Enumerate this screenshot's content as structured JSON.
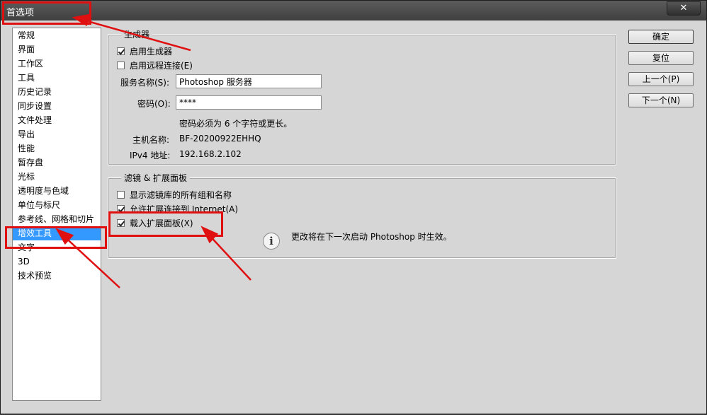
{
  "window": {
    "title": "首选项",
    "close_glyph": "✕"
  },
  "nav": {
    "items": [
      "常规",
      "界面",
      "工作区",
      "工具",
      "历史记录",
      "同步设置",
      "文件处理",
      "导出",
      "性能",
      "暂存盘",
      "光标",
      "透明度与色域",
      "单位与标尺",
      "参考线、网格和切片",
      "增效工具",
      "文字",
      "3D",
      "技术预览"
    ],
    "selected_index": 14
  },
  "generator": {
    "title": "生成器",
    "enable": {
      "label": "启用生成器",
      "checked": true
    },
    "remote": {
      "label": "启用远程连接(E)",
      "checked": false
    },
    "service_name": {
      "label": "服务名称(S):",
      "value": "Photoshop 服务器"
    },
    "password": {
      "label": "密码(O):",
      "value": "****"
    },
    "password_hint": "密码必须为 6 个字符或更长。",
    "host": {
      "label": "主机名称:",
      "value": "BF-20200922EHHQ"
    },
    "ipv4": {
      "label": "IPv4 地址:",
      "value": "192.168.2.102"
    }
  },
  "filters": {
    "title": "滤镜 & 扩展面板",
    "show_all": {
      "label": "显示滤镜库的所有组和名称",
      "checked": false
    },
    "allow_internet": {
      "label": "允许扩展连接到 Internet(A)",
      "checked": true
    },
    "load_panels": {
      "label": "载入扩展面板(X)",
      "checked": true
    },
    "info": "更改将在下一次启动 Photoshop 时生效。"
  },
  "buttons": {
    "ok": "确定",
    "reset": "复位",
    "prev": "上一个(P)",
    "next": "下一个(N)"
  },
  "annotation_color": "#e01010"
}
